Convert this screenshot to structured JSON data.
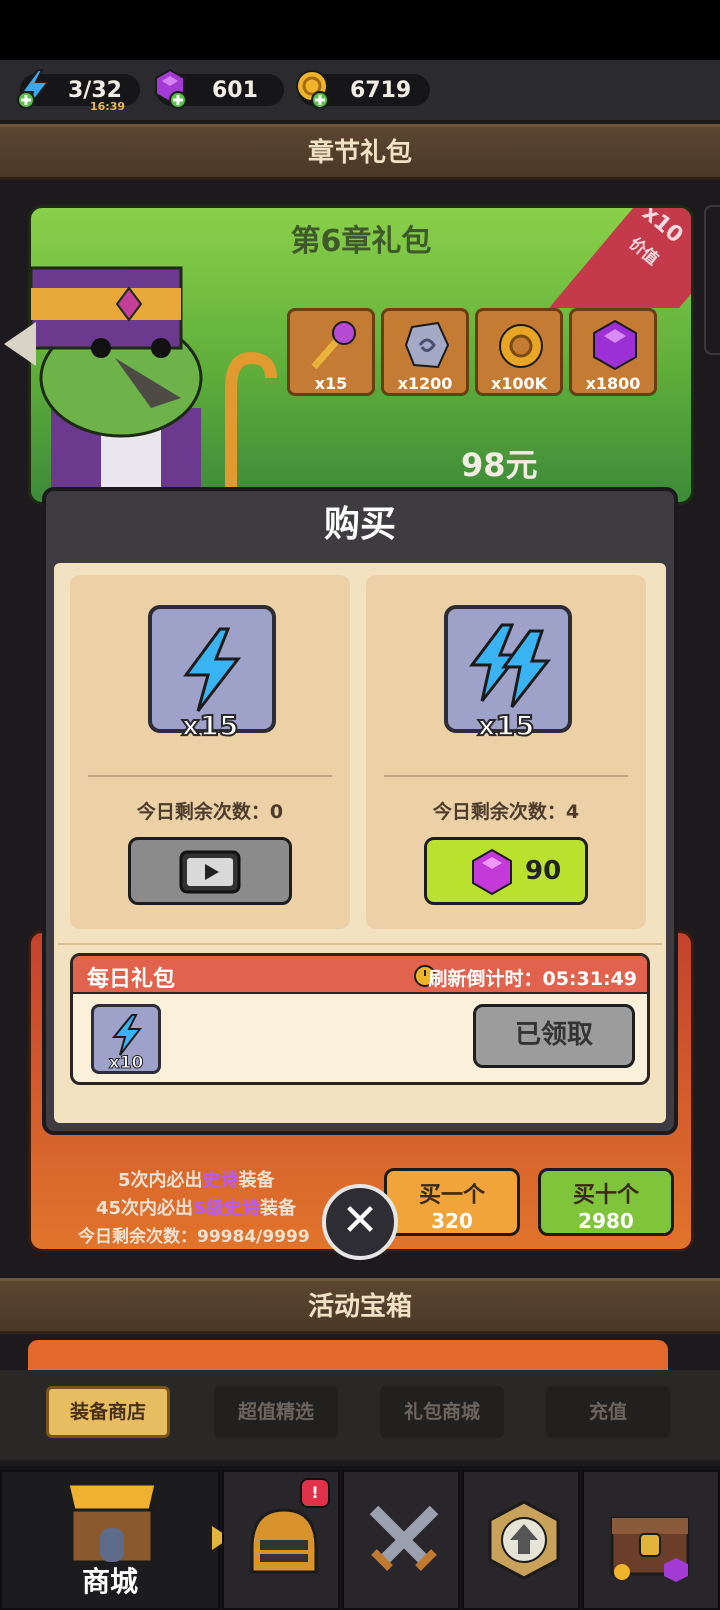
{
  "resources": {
    "energy": {
      "value": "3/32",
      "timer": "16:39",
      "icon": "lightning-plus-icon"
    },
    "gems": {
      "value": "601",
      "icon": "purple-gem-plus-icon"
    },
    "gold": {
      "value": "6719",
      "icon": "gold-coin-plus-icon"
    }
  },
  "chapter_section": {
    "header": "章节礼包",
    "pack_title": "第6章礼包",
    "value_badge": {
      "multiplier": "x10",
      "label": "价值"
    },
    "items": [
      {
        "icon": "staff-icon",
        "qty": "x15"
      },
      {
        "icon": "stone-icon",
        "qty": "x1200"
      },
      {
        "icon": "gold-ring-icon",
        "qty": "x100K"
      },
      {
        "icon": "purple-gem-icon",
        "qty": "x1800"
      }
    ],
    "price": "98元"
  },
  "modal": {
    "title": "购买",
    "offers": [
      {
        "icon": "lightning-icon",
        "qty": "x15",
        "remaining": "今日剩余次数：0",
        "action": "watch-video"
      },
      {
        "icon": "double-lightning-icon",
        "qty": "x15",
        "remaining": "今日剩余次数：4",
        "action": "buy",
        "cost": "90"
      }
    ],
    "daily": {
      "title": "每日礼包",
      "timer_label": "刷新倒计时：05:31:49",
      "item_qty": "x10",
      "claimed_label": "已领取"
    }
  },
  "gacha": {
    "line1_pre": "5次内必出",
    "line1_hl": "史诗",
    "line1_post": "装备",
    "line2_pre": "45次内必出",
    "line2_hl": "S级史诗",
    "line2_post": "装备",
    "remaining": "今日剩余次数：99984/9999",
    "buy_one": {
      "label": "买一个",
      "cost": "320"
    },
    "buy_ten": {
      "label": "买十个",
      "cost": "2980"
    }
  },
  "event_section": {
    "header": "活动宝箱"
  },
  "shop_tabs": [
    "装备商店",
    "超值精选",
    "礼包商城",
    "充值"
  ],
  "bottom_nav": {
    "shop_label": "商城",
    "badge": "!"
  },
  "colors": {
    "accent_green": "#b9e12e",
    "gem_purple": "#a23bd6",
    "header_red": "#e2634d"
  }
}
